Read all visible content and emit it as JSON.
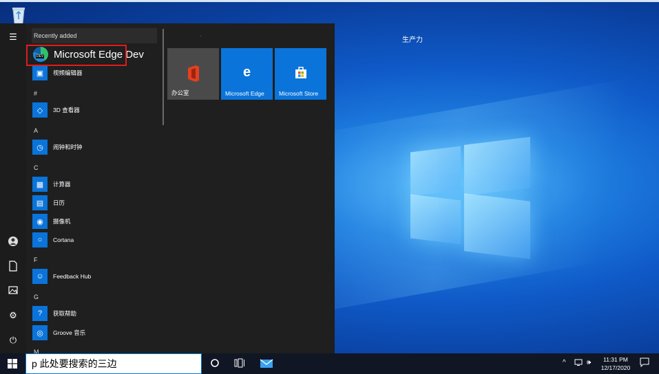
{
  "desktop": {
    "label": "生产力"
  },
  "start_menu": {
    "recent_header": "Recently added",
    "highlighted_app": "Microsoft Edge Dev",
    "highlighted_badge": "DEV",
    "apps": [
      {
        "section": "",
        "label": "视频编辑器",
        "icon": "video-editor-icon"
      },
      {
        "section": "#",
        "label": "3D 查看器",
        "icon": "cube-icon"
      },
      {
        "section": "A",
        "label": "闹钟和时钟",
        "icon": "clock-icon"
      },
      {
        "section": "C",
        "label": "计算器",
        "icon": "calculator-icon"
      },
      {
        "section": "",
        "label": "日历",
        "icon": "calendar-icon"
      },
      {
        "section": "",
        "label": "摄像机",
        "icon": "camera-icon"
      },
      {
        "section": "",
        "label": "Cortana",
        "icon": "cortana-icon"
      },
      {
        "section": "F",
        "label": "Feedback Hub",
        "icon": "feedback-icon"
      },
      {
        "section": "G",
        "label": "获取帮助",
        "icon": "help-icon"
      },
      {
        "section": "",
        "label": "Groove 音乐",
        "icon": "music-icon"
      }
    ],
    "letters": {
      "hash": "#",
      "a": "A",
      "c": "C",
      "f": "F",
      "g": "G",
      "m": "M"
    },
    "tiles_header": "·",
    "tiles": [
      {
        "label": "办公室",
        "color": "#4a4a4a",
        "icon": "office-icon"
      },
      {
        "label": "Microsoft Edge",
        "color": "#0a74da",
        "icon": "edge-icon"
      },
      {
        "label": "Microsoft Store",
        "color": "#0a74da",
        "icon": "store-icon"
      }
    ]
  },
  "taskbar": {
    "search_text": "p 此处要搜索的三边",
    "time": "11:31 PM",
    "date": "12/17/2020"
  },
  "colors": {
    "highlight_border": "#e21b1b",
    "tile_blue": "#0a74da",
    "start_bg": "#1f1f1f",
    "taskbar_bg": "#101624"
  }
}
